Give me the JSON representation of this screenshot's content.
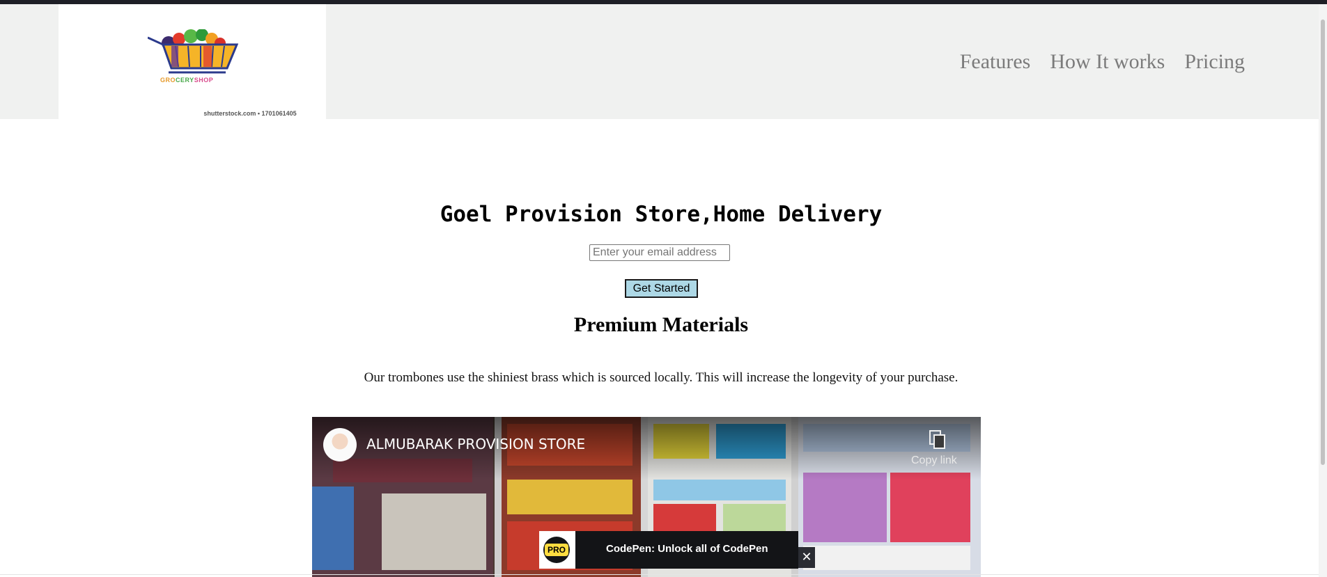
{
  "header": {
    "logo": {
      "wordmark_parts": [
        "GRO",
        "CERY",
        "SHOP"
      ],
      "icon": "grocery-cart-icon"
    },
    "watermark": "shutterstock.com • 1701061405",
    "nav": [
      "Features",
      "How It works",
      "Pricing"
    ]
  },
  "hero": {
    "title": "Goel Provision Store,Home Delivery",
    "email_placeholder": "Enter your email address",
    "email_value": "",
    "button_label": "Get Started"
  },
  "section": {
    "title": "Premium Materials",
    "text": "Our trombones use the shiniest brass which is sourced locally. This will increase the longevity of your purchase."
  },
  "video": {
    "channel_name": "ALMUBARAK PROVISION STORE",
    "copy_label": "Copy link",
    "copy_icon": "copy-icon"
  },
  "promo": {
    "badge": "PRO",
    "text": "CodePen: Unlock all of CodePen",
    "close": "✕"
  },
  "colors": {
    "header_bg": "#f0f1f0",
    "button_bg": "#add8e6",
    "nav_text": "#7b7b7b",
    "promo_bg": "#131417",
    "pro_badge": "#ffdd40"
  }
}
